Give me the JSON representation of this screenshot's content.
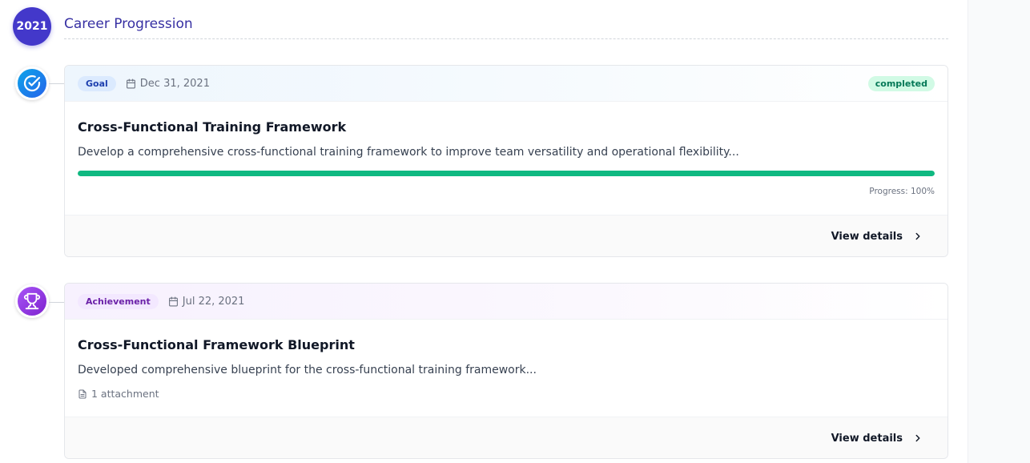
{
  "section": {
    "year": "2021",
    "title": "Career Progression"
  },
  "entries": [
    {
      "type_label": "Goal",
      "type_icon": "check-circle-icon",
      "date": "Dec 31, 2021",
      "status": "completed",
      "title": "Cross-Functional Training Framework",
      "description": "Develop a comprehensive cross-functional training framework to improve team versatility and operational flexibility...",
      "progress_percent": 100,
      "progress_label": "Progress: 100%",
      "view_label": "View details",
      "accent": "#0ea5e9"
    },
    {
      "type_label": "Achievement",
      "type_icon": "trophy-icon",
      "date": "Jul 22, 2021",
      "title": "Cross-Functional Framework Blueprint",
      "description": "Developed comprehensive blueprint for the cross-functional training framework...",
      "attachments": "1 attachment",
      "view_label": "View details",
      "accent": "#9333ea"
    }
  ],
  "colors": {
    "year_badge": "#4338ca",
    "progress": "#10b981",
    "status_bg": "#d1fae5"
  }
}
